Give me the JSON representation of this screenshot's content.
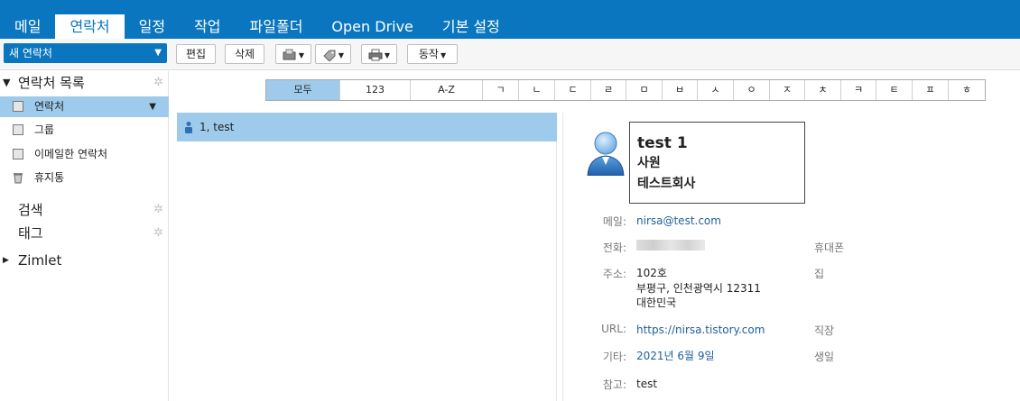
{
  "nav": {
    "tabs": [
      "메일",
      "연락처",
      "일정",
      "작업",
      "파일폴더",
      "Open Drive",
      "기본 설정"
    ],
    "active_index": 1
  },
  "toolbar": {
    "new_label": "새 연락처",
    "edit_label": "편집",
    "delete_label": "삭제",
    "action_label": "동작"
  },
  "sidebar": {
    "contacts_header": "연락처 목록",
    "items": [
      {
        "label": "연락처",
        "selected": true
      },
      {
        "label": "그룹"
      },
      {
        "label": "이메일한 연락처"
      },
      {
        "label": "휴지통"
      }
    ],
    "search_header": "검색",
    "tags_header": "태그",
    "zimlet_header": "Zimlet"
  },
  "alpha_filter": [
    "모두",
    "123",
    "A-Z",
    "ㄱ",
    "ㄴ",
    "ㄷ",
    "ㄹ",
    "ㅁ",
    "ㅂ",
    "ㅅ",
    "ㅇ",
    "ㅈ",
    "ㅊ",
    "ㅋ",
    "ㅌ",
    "ㅍ",
    "ㅎ"
  ],
  "list": {
    "rows": [
      {
        "label": "1, test",
        "selected": true
      }
    ]
  },
  "detail": {
    "name": "test 1",
    "title": "사원",
    "company": "테스트회사",
    "email_key": "메일:",
    "email": "nirsa@test.com",
    "phone_key": "전화:",
    "phone_type": "휴대폰",
    "address_key": "주소:",
    "address_line1": "102호",
    "address_line2": "부평구, 인천광역시 12311",
    "address_line3": "대한민국",
    "address_type": "집",
    "url_key": "URL:",
    "url": "https://nirsa.tistory.com",
    "url_type": "직장",
    "other_key": "기타:",
    "other": "2021년 6월 9일",
    "other_type": "생일",
    "note_key": "참고:",
    "note": "test"
  },
  "colors": {
    "brand": "#0a76bf",
    "selected": "#9ecbeb",
    "link": "#1f5f9a"
  }
}
